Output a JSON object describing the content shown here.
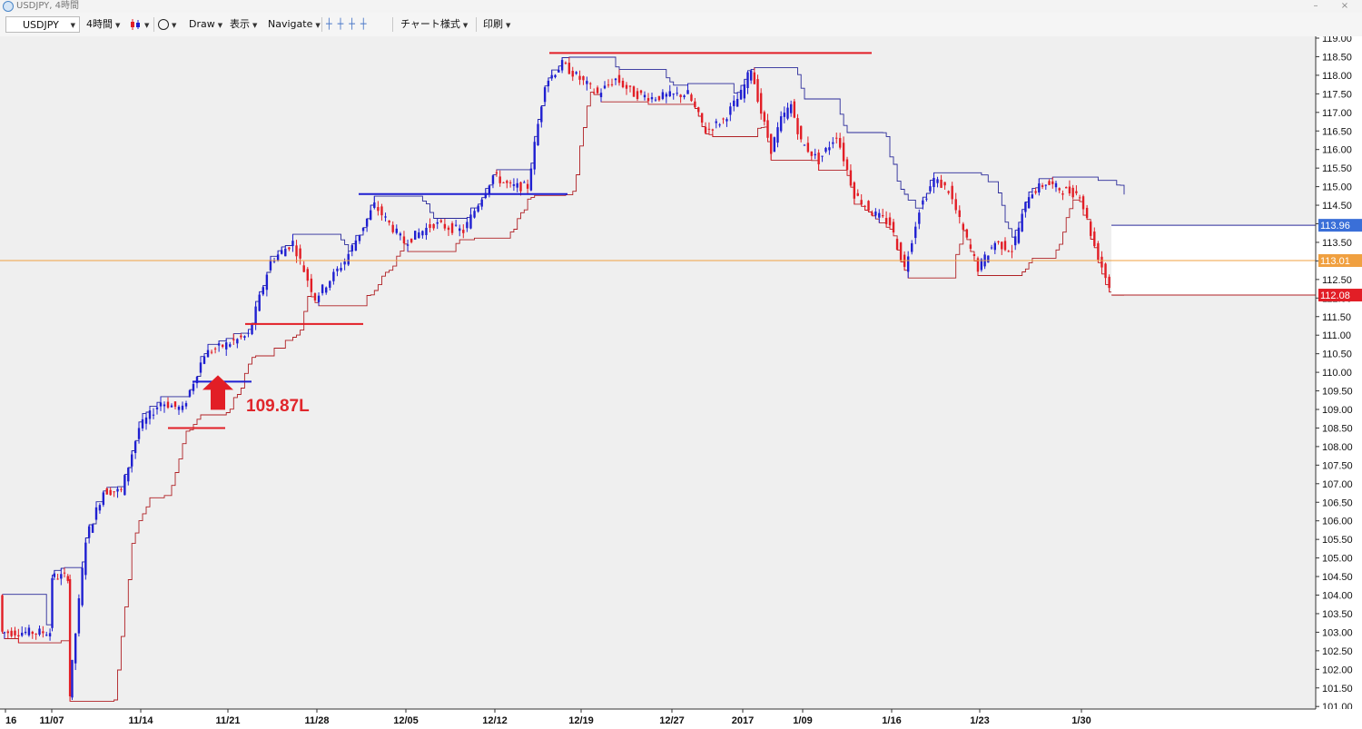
{
  "window": {
    "title": "USDJPY, 4時間",
    "minimize": "–",
    "close": "×"
  },
  "toolbar": {
    "symbol": "USDJPY",
    "timeframe": "4時間",
    "draw": "Draw",
    "display": "表示",
    "navigate": "Navigate",
    "chart_style": "チャート様式",
    "print": "印刷"
  },
  "colors": {
    "up": "#1f1fd1",
    "down": "#e21e26",
    "channel_upper": "#2a2a9a",
    "channel_lower": "#b02025",
    "current_price": "#f0a040",
    "background": "#efefef"
  },
  "chart_data": {
    "type": "candlestick",
    "symbol": "USDJPY",
    "timeframe": "4時間",
    "ylim": [
      101.0,
      119.1
    ],
    "y_ticks": [
      "119.00",
      "118.50",
      "118.00",
      "117.50",
      "117.00",
      "116.50",
      "116.00",
      "115.50",
      "115.00",
      "114.50",
      "114.00",
      "113.50",
      "113.00",
      "112.50",
      "112.00",
      "111.50",
      "111.00",
      "110.50",
      "110.00",
      "109.50",
      "109.00",
      "108.50",
      "108.00",
      "107.50",
      "107.00",
      "106.50",
      "106.00",
      "105.50",
      "105.00",
      "104.50",
      "104.00",
      "103.50",
      "103.00",
      "102.50",
      "102.00",
      "101.50",
      "101.00"
    ],
    "x_ticks": [
      "16",
      "11/07",
      "11/14",
      "11/21",
      "11/28",
      "12/05",
      "12/12",
      "12/19",
      "12/27",
      "2017",
      "1/09",
      "1/16",
      "1/23",
      "1/30"
    ],
    "price_badges": [
      {
        "label": "113.96",
        "value": 113.96,
        "color": "#3a6fd8"
      },
      {
        "label": "113.01",
        "value": 113.01,
        "color": "#f0a040"
      },
      {
        "label": "112.08",
        "value": 112.08,
        "color": "#e21e26"
      }
    ],
    "annotation": {
      "text": "109.87L",
      "value": 109.87
    },
    "price_path": [
      {
        "t": "11/04",
        "p": 104.0
      },
      {
        "t": "11/04",
        "p": 103.0
      },
      {
        "t": "11/07",
        "p": 103.0
      },
      {
        "t": "11/07",
        "p": 104.5
      },
      {
        "t": "11/09",
        "p": 104.5
      },
      {
        "t": "11/09",
        "p": 101.3
      },
      {
        "t": "11/10",
        "p": 105.5
      },
      {
        "t": "11/11",
        "p": 106.8
      },
      {
        "t": "11/13",
        "p": 106.8
      },
      {
        "t": "11/14",
        "p": 108.5
      },
      {
        "t": "11/16",
        "p": 109.2
      },
      {
        "t": "11/18",
        "p": 109.0
      },
      {
        "t": "11/19",
        "p": 110.5
      },
      {
        "t": "11/22",
        "p": 111.0
      },
      {
        "t": "11/24",
        "p": 113.0
      },
      {
        "t": "11/25",
        "p": 113.5
      },
      {
        "t": "11/28",
        "p": 112.0
      },
      {
        "t": "11/30",
        "p": 113.0
      },
      {
        "t": "12/01",
        "p": 114.5
      },
      {
        "t": "12/05",
        "p": 113.5
      },
      {
        "t": "12/08",
        "p": 114.0
      },
      {
        "t": "12/10",
        "p": 113.8
      },
      {
        "t": "12/12",
        "p": 115.3
      },
      {
        "t": "12/14",
        "p": 115.0
      },
      {
        "t": "12/16",
        "p": 115.0
      },
      {
        "t": "12/17",
        "p": 117.8
      },
      {
        "t": "12/18",
        "p": 118.3
      },
      {
        "t": "12/20",
        "p": 117.5
      },
      {
        "t": "12/22",
        "p": 117.9
      },
      {
        "t": "12/24",
        "p": 117.5
      },
      {
        "t": "12/26",
        "p": 117.4
      },
      {
        "t": "12/28",
        "p": 117.5
      },
      {
        "t": "12/29",
        "p": 116.5
      },
      {
        "t": "12/31",
        "p": 116.8
      },
      {
        "t": "2017",
        "p": 117.5
      },
      {
        "t": "1/03",
        "p": 118.2
      },
      {
        "t": "1/04",
        "p": 117.0
      },
      {
        "t": "1/05",
        "p": 116.0
      },
      {
        "t": "1/06",
        "p": 116.8
      },
      {
        "t": "1/08",
        "p": 117.2
      },
      {
        "t": "1/09",
        "p": 116.2
      },
      {
        "t": "1/11",
        "p": 115.7
      },
      {
        "t": "1/12",
        "p": 116.4
      },
      {
        "t": "1/13",
        "p": 114.8
      },
      {
        "t": "1/14",
        "p": 114.3
      },
      {
        "t": "1/16",
        "p": 114.0
      },
      {
        "t": "1/17",
        "p": 112.8
      },
      {
        "t": "1/18",
        "p": 114.4
      },
      {
        "t": "1/19",
        "p": 115.2
      },
      {
        "t": "1/20",
        "p": 114.9
      },
      {
        "t": "1/21",
        "p": 113.8
      },
      {
        "t": "1/23",
        "p": 112.8
      },
      {
        "t": "1/24",
        "p": 113.5
      },
      {
        "t": "1/25",
        "p": 113.3
      },
      {
        "t": "1/26",
        "p": 114.8
      },
      {
        "t": "1/27",
        "p": 115.1
      },
      {
        "t": "1/28",
        "p": 114.9
      },
      {
        "t": "1/30",
        "p": 114.8
      },
      {
        "t": "1/31",
        "p": 113.4
      },
      {
        "t": "2/01",
        "p": 112.3
      },
      {
        "t": "2/02",
        "p": 113.0
      }
    ],
    "support_resistance_lines": [
      {
        "color": "red",
        "value": 118.6
      },
      {
        "color": "blue",
        "value": 114.8
      },
      {
        "color": "red",
        "value": 111.3
      },
      {
        "color": "blue",
        "value": 109.75
      },
      {
        "color": "red",
        "value": 108.5
      }
    ]
  }
}
